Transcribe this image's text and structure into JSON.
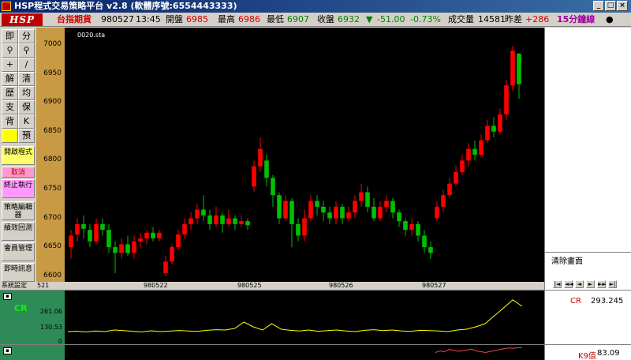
{
  "window": {
    "title": "HSP程式交易策略平台 v2.8 (軟體序號:6554443333)",
    "buttons": [
      "_",
      "□",
      "×"
    ]
  },
  "quote": {
    "logo": "HSP",
    "product": "台指期貨",
    "date": "980527",
    "time": "13:45",
    "open_label": "開盤",
    "open": "6985",
    "high_label": "最高",
    "high": "6986",
    "low_label": "最低",
    "low": "6907",
    "close_label": "收盤",
    "close": "6932",
    "change_arrow": "▼",
    "change": "-51.00",
    "change_pct": "-0.73%",
    "volume_label": "成交量",
    "volume": "14581",
    "diff_label": "昨差",
    "diff": "+286",
    "period": "15分鐘線",
    "status_dot": "●"
  },
  "toolbar": {
    "rows": [
      [
        "即",
        "分"
      ],
      [
        "⚲",
        "⚲"
      ],
      [
        "+",
        "/"
      ],
      [
        "解",
        "清"
      ],
      [
        "歷",
        "均"
      ],
      [
        "支",
        "保"
      ],
      [
        "背",
        "K"
      ],
      [
        "",
        "預"
      ]
    ],
    "open_strategy": "開啟程式",
    "cancel": "取消",
    "stop_exec": "終止執行",
    "strategy_editor": "策略編輯器",
    "performance": "績效回測",
    "member_manage": "會員管理",
    "realtime_info": "即時訊息",
    "system_settings": "系統設定"
  },
  "chart": {
    "series_label": "0020.sta",
    "right_label": "清除畫面",
    "y_ticks": [
      "7000",
      "6950",
      "6900",
      "6850",
      "6800",
      "6750",
      "6700",
      "6650",
      "6600"
    ],
    "x_labels": [
      "521",
      "980522",
      "980525",
      "980526",
      "980527"
    ],
    "nav_buttons": [
      "|◄",
      "◄◄",
      "◄",
      "►",
      "►►",
      "►|"
    ]
  },
  "chart_data": [
    {
      "type": "candlestick",
      "title": "",
      "series_label": "0020.sta",
      "xlabel": "",
      "ylabel": "",
      "ylim": [
        6590,
        7030
      ],
      "x_ticks": [
        "521",
        "980522",
        "980525",
        "980526",
        "980527"
      ],
      "y_ticks": [
        7000,
        6950,
        6900,
        6850,
        6800,
        6750,
        6700,
        6650,
        6600
      ],
      "candles": [
        {
          "o": 6650,
          "c": 6670,
          "h": 6680,
          "l": 6630
        },
        {
          "o": 6672,
          "c": 6690,
          "h": 6700,
          "l": 6660
        },
        {
          "o": 6690,
          "c": 6682,
          "h": 6705,
          "l": 6665
        },
        {
          "o": 6680,
          "c": 6660,
          "h": 6690,
          "l": 6650
        },
        {
          "o": 6660,
          "c": 6690,
          "h": 6700,
          "l": 6655
        },
        {
          "o": 6690,
          "c": 6680,
          "h": 6700,
          "l": 6670
        },
        {
          "o": 6680,
          "c": 6650,
          "h": 6690,
          "l": 6640
        },
        {
          "o": 6650,
          "c": 6640,
          "h": 6660,
          "l": 6605
        },
        {
          "o": 6640,
          "c": 6655,
          "h": 6665,
          "l": 6630
        },
        {
          "o": 6655,
          "c": 6640,
          "h": 6670,
          "l": 6635
        },
        {
          "o": 6640,
          "c": 6660,
          "h": 6670,
          "l": 6630
        },
        {
          "o": 6660,
          "c": 6665,
          "h": 6675,
          "l": 6650
        },
        {
          "o": 6665,
          "c": 6675,
          "h": 6680,
          "l": 6655
        },
        {
          "o": 6675,
          "c": 6665,
          "h": 6685,
          "l": 6660
        },
        {
          "o": 6665,
          "c": 6675,
          "h": 6680,
          "l": 6660
        },
        {
          "o": 6605,
          "c": 6625,
          "h": 6635,
          "l": 6600
        },
        {
          "o": 6625,
          "c": 6650,
          "h": 6655,
          "l": 6620
        },
        {
          "o": 6650,
          "c": 6672,
          "h": 6680,
          "l": 6645
        },
        {
          "o": 6672,
          "c": 6690,
          "h": 6700,
          "l": 6665
        },
        {
          "o": 6690,
          "c": 6700,
          "h": 6710,
          "l": 6680
        },
        {
          "o": 6700,
          "c": 6715,
          "h": 6725,
          "l": 6690
        },
        {
          "o": 6715,
          "c": 6705,
          "h": 6740,
          "l": 6695
        },
        {
          "o": 6705,
          "c": 6690,
          "h": 6715,
          "l": 6680
        },
        {
          "o": 6690,
          "c": 6705,
          "h": 6720,
          "l": 6685
        },
        {
          "o": 6705,
          "c": 6690,
          "h": 6710,
          "l": 6675
        },
        {
          "o": 6690,
          "c": 6700,
          "h": 6715,
          "l": 6685
        },
        {
          "o": 6700,
          "c": 6690,
          "h": 6705,
          "l": 6680
        },
        {
          "o": 6690,
          "c": 6695,
          "h": 6705,
          "l": 6685
        },
        {
          "o": 6695,
          "c": 6688,
          "h": 6700,
          "l": 6680
        },
        {
          "o": 6755,
          "c": 6790,
          "h": 6800,
          "l": 6745
        },
        {
          "o": 6790,
          "c": 6820,
          "h": 6840,
          "l": 6780
        },
        {
          "o": 6800,
          "c": 6770,
          "h": 6810,
          "l": 6755
        },
        {
          "o": 6770,
          "c": 6740,
          "h": 6775,
          "l": 6720
        },
        {
          "o": 6740,
          "c": 6700,
          "h": 6745,
          "l": 6690
        },
        {
          "o": 6700,
          "c": 6730,
          "h": 6740,
          "l": 6695
        },
        {
          "o": 6730,
          "c": 6690,
          "h": 6735,
          "l": 6650
        },
        {
          "o": 6690,
          "c": 6670,
          "h": 6700,
          "l": 6660
        },
        {
          "o": 6670,
          "c": 6700,
          "h": 6715,
          "l": 6660
        },
        {
          "o": 6700,
          "c": 6730,
          "h": 6740,
          "l": 6695
        },
        {
          "o": 6730,
          "c": 6720,
          "h": 6740,
          "l": 6705
        },
        {
          "o": 6720,
          "c": 6710,
          "h": 6730,
          "l": 6695
        },
        {
          "o": 6710,
          "c": 6700,
          "h": 6720,
          "l": 6690
        },
        {
          "o": 6700,
          "c": 6720,
          "h": 6730,
          "l": 6690
        },
        {
          "o": 6720,
          "c": 6700,
          "h": 6725,
          "l": 6690
        },
        {
          "o": 6700,
          "c": 6710,
          "h": 6720,
          "l": 6695
        },
        {
          "o": 6710,
          "c": 6730,
          "h": 6740,
          "l": 6700
        },
        {
          "o": 6730,
          "c": 6745,
          "h": 6760,
          "l": 6720
        },
        {
          "o": 6745,
          "c": 6720,
          "h": 6755,
          "l": 6710
        },
        {
          "o": 6720,
          "c": 6700,
          "h": 6735,
          "l": 6695
        },
        {
          "o": 6700,
          "c": 6720,
          "h": 6730,
          "l": 6695
        },
        {
          "o": 6720,
          "c": 6730,
          "h": 6740,
          "l": 6710
        },
        {
          "o": 6730,
          "c": 6710,
          "h": 6735,
          "l": 6700
        },
        {
          "o": 6710,
          "c": 6695,
          "h": 6715,
          "l": 6685
        },
        {
          "o": 6695,
          "c": 6680,
          "h": 6700,
          "l": 6670
        },
        {
          "o": 6680,
          "c": 6690,
          "h": 6700,
          "l": 6670
        },
        {
          "o": 6690,
          "c": 6670,
          "h": 6695,
          "l": 6660
        },
        {
          "o": 6670,
          "c": 6650,
          "h": 6680,
          "l": 6640
        },
        {
          "o": 6650,
          "c": 6640,
          "h": 6660,
          "l": 6630
        },
        {
          "o": 6700,
          "c": 6720,
          "h": 6730,
          "l": 6695
        },
        {
          "o": 6720,
          "c": 6740,
          "h": 6750,
          "l": 6710
        },
        {
          "o": 6740,
          "c": 6760,
          "h": 6770,
          "l": 6735
        },
        {
          "o": 6760,
          "c": 6780,
          "h": 6790,
          "l": 6755
        },
        {
          "o": 6780,
          "c": 6800,
          "h": 6810,
          "l": 6775
        },
        {
          "o": 6800,
          "c": 6820,
          "h": 6830,
          "l": 6790
        },
        {
          "o": 6820,
          "c": 6810,
          "h": 6835,
          "l": 6800
        },
        {
          "o": 6810,
          "c": 6835,
          "h": 6845,
          "l": 6805
        },
        {
          "o": 6835,
          "c": 6860,
          "h": 6870,
          "l": 6830
        },
        {
          "o": 6860,
          "c": 6850,
          "h": 6875,
          "l": 6840
        },
        {
          "o": 6850,
          "c": 6880,
          "h": 6890,
          "l": 6845
        },
        {
          "o": 6880,
          "c": 6930,
          "h": 6940,
          "l": 6870
        },
        {
          "o": 6930,
          "c": 6990,
          "h": 6998,
          "l": 6920
        },
        {
          "o": 6985,
          "c": 6932,
          "h": 6986,
          "l": 6907
        }
      ]
    },
    {
      "type": "line",
      "title": "",
      "series_label": "CR",
      "y_ticks": [
        261.06,
        130.53,
        0
      ],
      "latest": 293.245,
      "values": [
        60,
        62,
        58,
        64,
        60,
        70,
        66,
        62,
        58,
        65,
        60,
        63,
        67,
        64,
        61,
        68,
        72,
        70,
        80,
        120,
        90,
        70,
        110,
        75,
        68,
        64,
        70,
        62,
        66,
        70,
        64,
        60,
        68,
        72,
        66,
        70,
        64,
        62,
        68,
        66,
        64,
        60,
        70,
        75,
        90,
        110,
        160,
        210,
        261,
        220
      ]
    },
    {
      "type": "line",
      "title": "",
      "series_label": "K9值",
      "latest": 83.09,
      "values": [
        50,
        60,
        55,
        70,
        65,
        58,
        62,
        68,
        72,
        60,
        55,
        50,
        58,
        62,
        70,
        75,
        80,
        78,
        82,
        83
      ]
    }
  ],
  "indicators": {
    "cr_name": "CR",
    "cr_label": "CR",
    "cr_value": "293.245",
    "cr_scale": [
      "261.06",
      "130.53",
      "0"
    ],
    "k9_label": "K9值",
    "k9_value": "83.09"
  },
  "colors": {
    "up": "#ff0000",
    "down": "#00c000",
    "chart_bg": "#000000",
    "cr_line": "#ffff00",
    "panel_accent": "#2e8b57",
    "gold": "#c89a44"
  }
}
